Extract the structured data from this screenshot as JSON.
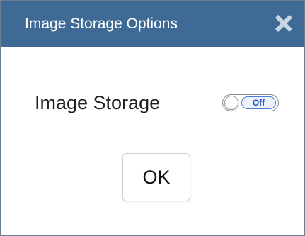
{
  "dialog": {
    "title": "Image Storage Options",
    "close_icon": "close-icon"
  },
  "setting": {
    "label": "Image Storage",
    "toggle_state_text": "Off",
    "toggle_on": false
  },
  "actions": {
    "ok_label": "OK"
  },
  "colors": {
    "titlebar_bg": "#3f6a95",
    "title_text": "#ffffff",
    "toggle_accent": "#1f4fbf"
  }
}
